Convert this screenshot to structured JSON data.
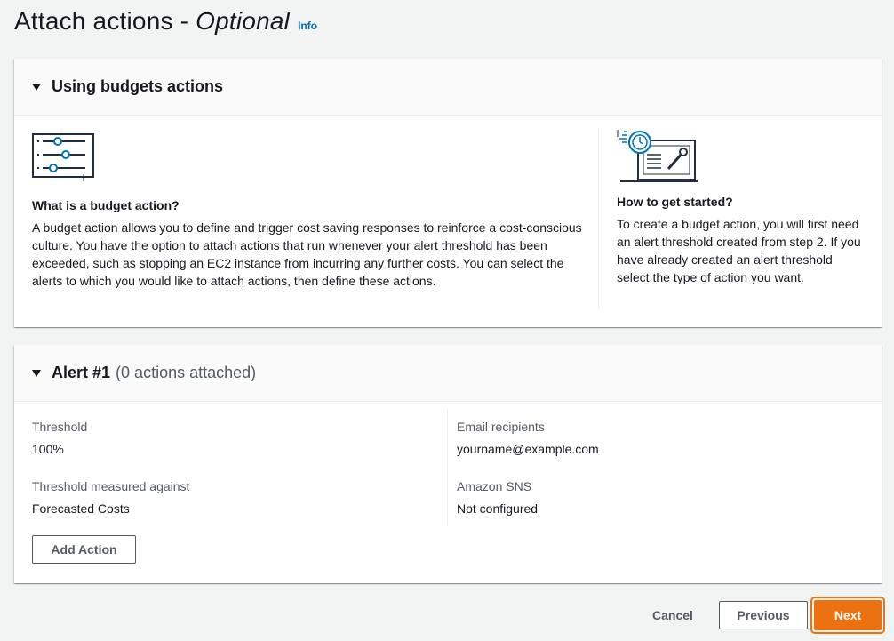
{
  "header": {
    "title_main": "Attach actions - ",
    "title_optional": "Optional",
    "info": "Info"
  },
  "budgets_section": {
    "title": "Using budgets actions",
    "what": {
      "heading": "What is a budget action?",
      "text": "A budget action allows you to define and trigger cost saving responses to reinforce a cost-conscious culture. You have the option to attach actions that run whenever your alert threshold has been exceeded, such as stopping an EC2 instance from incurring any further costs. You can select the alerts to which you would like to attach actions, then define these actions."
    },
    "how": {
      "heading": "How to get started?",
      "text": "To create a budget action, you will first need an alert threshold created from step 2. If you have already created an alert threshold select the type of action you want."
    }
  },
  "alert": {
    "title": "Alert #1",
    "subtitle": "(0 actions attached)",
    "threshold_label": "Threshold",
    "threshold_value": "100%",
    "measured_label": "Threshold measured against",
    "measured_value": "Forecasted Costs",
    "email_label": "Email recipients",
    "email_value": "yourname@example.com",
    "sns_label": "Amazon SNS",
    "sns_value": "Not configured",
    "add_action": "Add Action"
  },
  "footer": {
    "cancel": "Cancel",
    "previous": "Previous",
    "next": "Next"
  },
  "colors": {
    "accent": "#ec7211",
    "link": "#0073bb",
    "icon_blue": "#0073bb"
  },
  "icons": [
    "sliders-icon",
    "laptop-wrench-icon",
    "caret-down-icon"
  ]
}
